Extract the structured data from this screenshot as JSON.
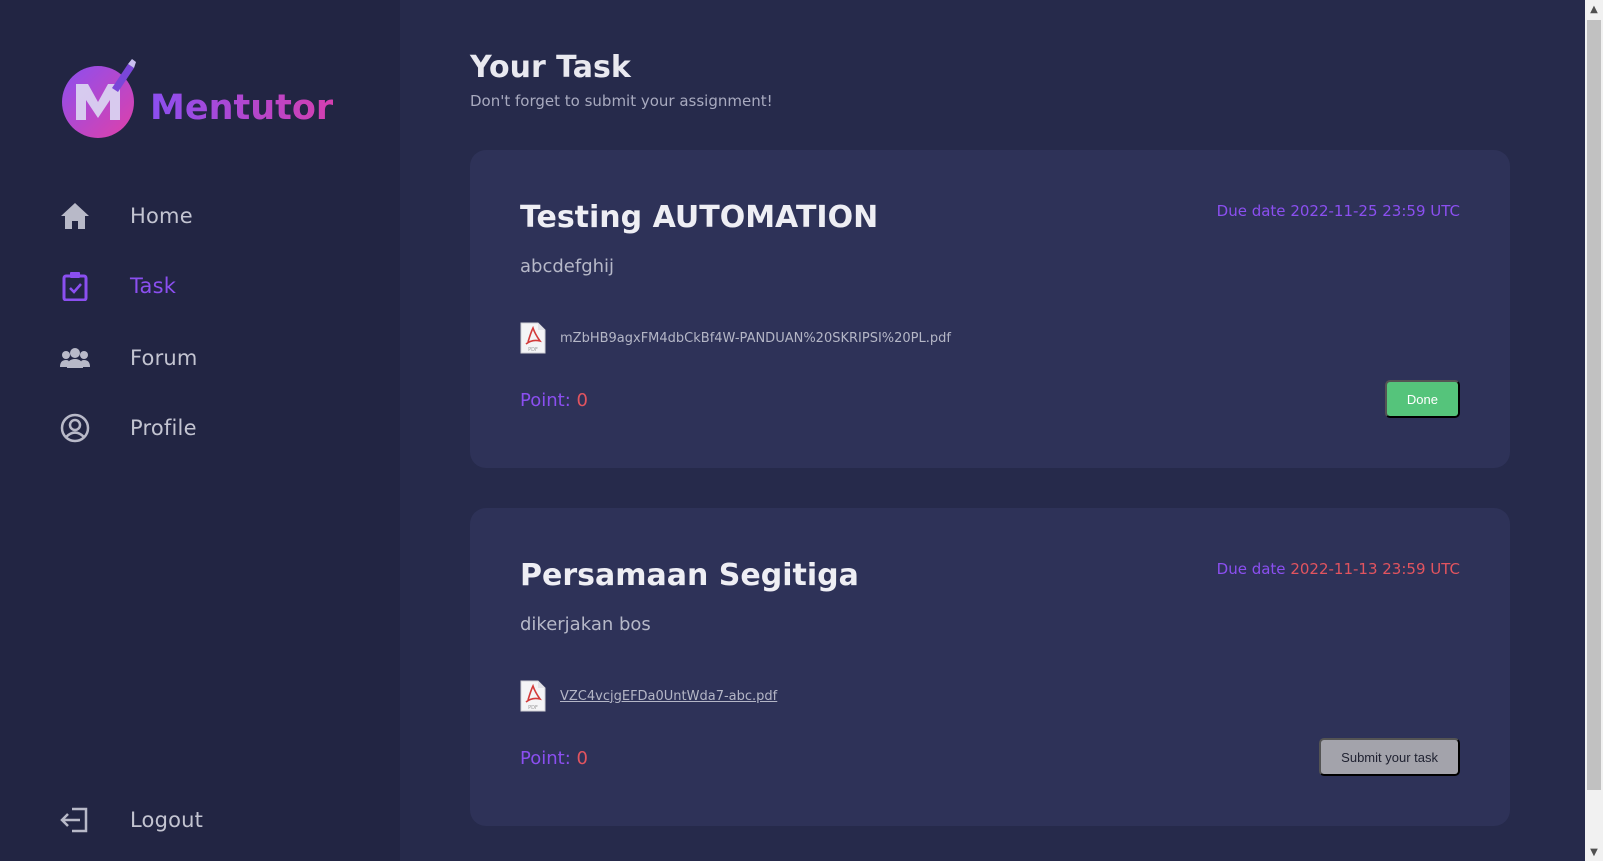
{
  "app": {
    "name": "Mentutor",
    "logo_letter": "M"
  },
  "sidebar": {
    "items": [
      {
        "label": "Home",
        "icon": "home-icon"
      },
      {
        "label": "Task",
        "icon": "clipboard-check-icon"
      },
      {
        "label": "Forum",
        "icon": "users-icon"
      },
      {
        "label": "Profile",
        "icon": "user-circle-icon"
      }
    ],
    "active": "Task",
    "logout_label": "Logout"
  },
  "main": {
    "title": "Your Task",
    "subtitle": "Don't forget to submit your assignment!"
  },
  "tasks": [
    {
      "title": "Testing AUTOMATION",
      "description": "abcdefghij",
      "due_label": "Due date",
      "due_value": "2022-11-25 23:59 UTC",
      "file_name": "mZbHB9agxFM4dbCkBf4W-PANDUAN%20SKRIPSI%20PL.pdf",
      "point_label": "Point:",
      "point_value": "0",
      "action_label": "Done"
    },
    {
      "title": "Persamaan Segitiga",
      "description": "dikerjakan bos",
      "due_label": "Due date",
      "due_value": "2022-11-13 23:59 UTC",
      "file_name": "VZC4vcjgEFDa0UntWda7-abc.pdf",
      "point_label": "Point:",
      "point_value": "0",
      "action_label": "Submit your task"
    }
  ],
  "colors": {
    "accent": "#8b4ff0",
    "danger": "#e2545f",
    "success": "#55c47b",
    "card": "#2e3258",
    "sidebar": "#222543",
    "background": "#262a4b"
  }
}
